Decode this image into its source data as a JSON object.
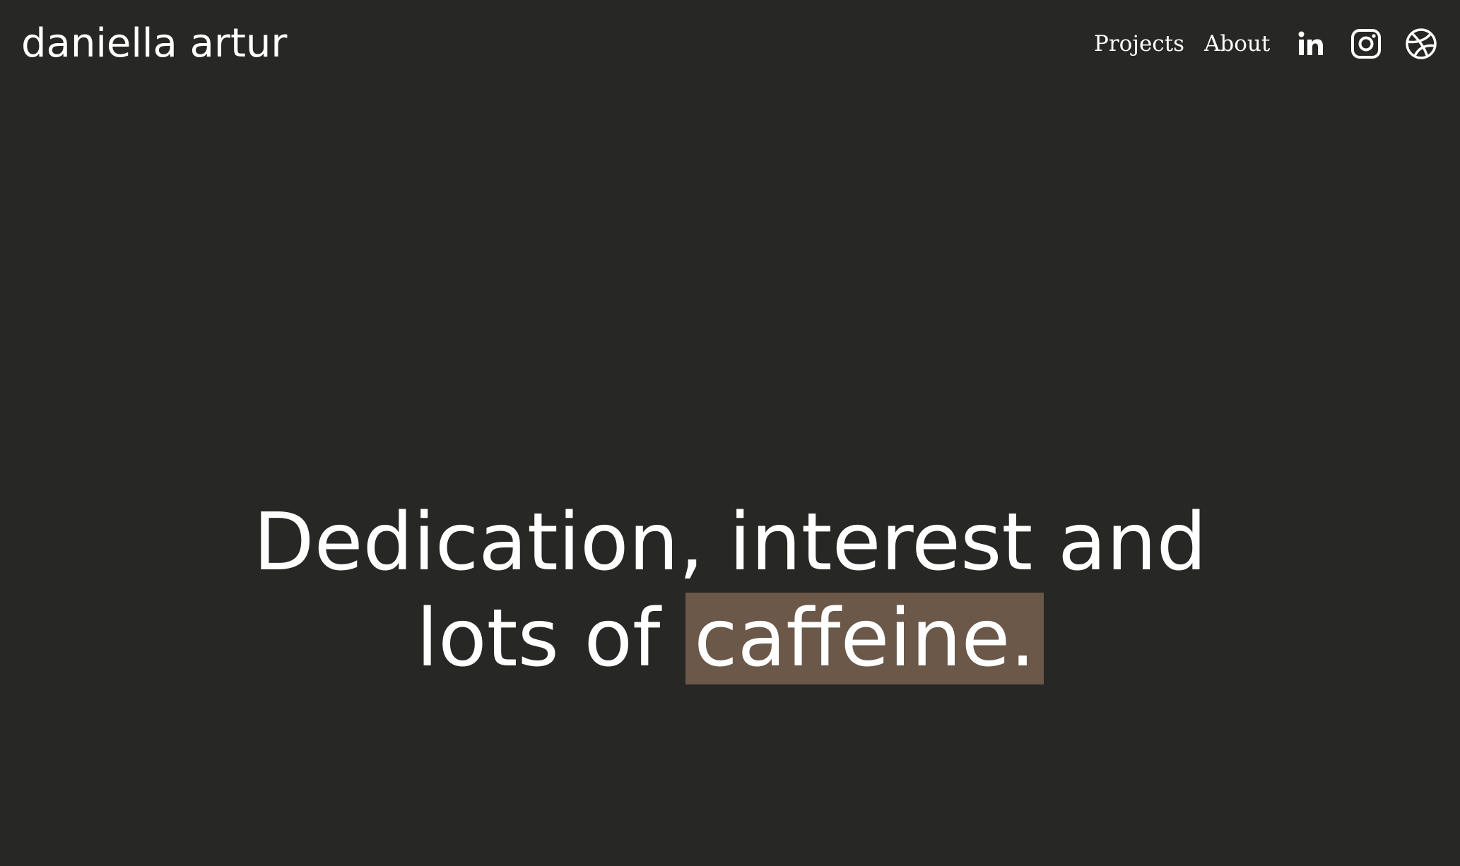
{
  "header": {
    "brand": "daniella artur",
    "nav": [
      {
        "label": "Projects"
      },
      {
        "label": "About"
      }
    ],
    "social_icons": [
      "linkedin-icon",
      "instagram-icon",
      "dribbble-icon"
    ]
  },
  "hero": {
    "line1": "Dedication, interest and",
    "line2_prefix": "lots of ",
    "line2_highlight": "caffeine."
  },
  "colors": {
    "background": "#272725",
    "text": "#ffffff",
    "highlight": "#6b5849"
  }
}
